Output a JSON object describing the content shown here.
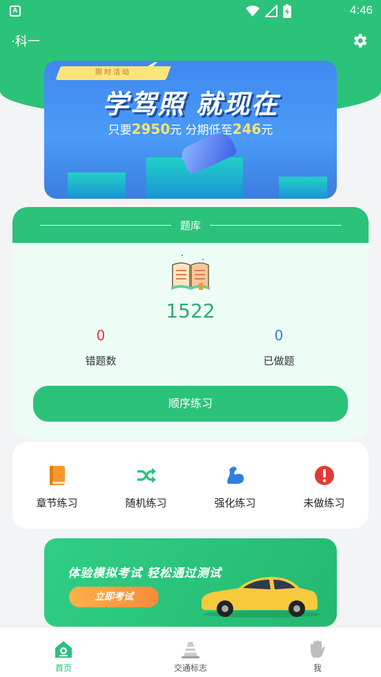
{
  "status_bar": {
    "time": "4:46",
    "app_indicator": "A"
  },
  "header": {
    "subject": "·科一",
    "settings_icon": "gear-icon"
  },
  "promo_banner": {
    "ribbon": "限时活动",
    "headline": "学驾照 就现在",
    "sub_prefix": "只要",
    "price": "2950",
    "sub_mid": "元 分期低至",
    "installment": "246",
    "sub_suffix": "元"
  },
  "question_bank": {
    "title": "题库",
    "total": "1522",
    "wrong_count": "0",
    "wrong_label": "错题数",
    "done_count": "0",
    "done_label": "已做题",
    "sequential_button": "顺序练习",
    "colors": {
      "wrong": "#e53935",
      "done": "#2f7fdc"
    }
  },
  "practice_modes": [
    {
      "label": "章节练习",
      "icon": "book-icon",
      "color": "#f89a2b"
    },
    {
      "label": "随机练习",
      "icon": "shuffle-icon",
      "color": "#2bc27a"
    },
    {
      "label": "强化练习",
      "icon": "muscle-icon",
      "color": "#2f7fdc"
    },
    {
      "label": "未做练习",
      "icon": "alert-icon",
      "color": "#e53935"
    }
  ],
  "exam_banner": {
    "title": "体验模拟考试 轻松通过测试",
    "button": "立即考试"
  },
  "bottom_nav": [
    {
      "label": "首页",
      "icon": "home-icon",
      "active": true
    },
    {
      "label": "交通标志",
      "icon": "traffic-cone-icon",
      "active": false
    },
    {
      "label": "我",
      "icon": "hand-icon",
      "active": false
    }
  ],
  "colors": {
    "primary": "#2bc27a",
    "accent_blue": "#3f88f0",
    "page_bg": "#f2f4f5"
  }
}
